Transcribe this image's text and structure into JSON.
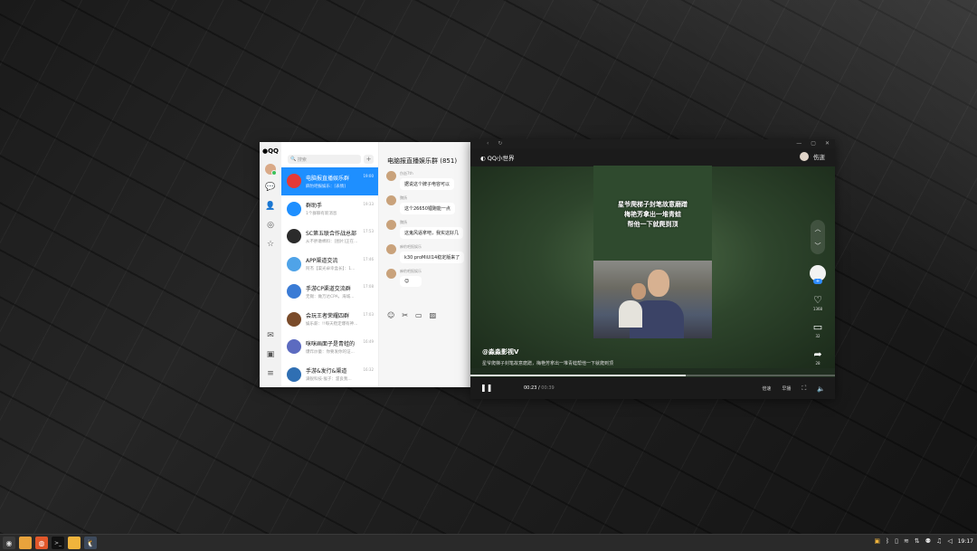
{
  "qq": {
    "logo": "QQ",
    "search_placeholder": "搜索",
    "search_plus": "+",
    "rail_icons": [
      "avatar",
      "message-icon",
      "contacts-icon",
      "space-icon",
      "favorites-icon",
      "mail-icon",
      "doc-icon",
      "menu-icon"
    ],
    "chats": [
      {
        "name": "电脑报直播娱乐群",
        "preview": "麻豹吧报娱乐：[表情]",
        "time": "19:00",
        "color": "#e53935",
        "selected": true
      },
      {
        "name": "群助手",
        "preview": "1个群聊有新消息",
        "time": "19:33",
        "color": "#1e8fff",
        "selected": false
      },
      {
        "name": "SC第五联合作战总部",
        "preview": "从不胖墩棉料：[图片]正在...",
        "time": "17:53",
        "color": "#2b2b2b",
        "selected": false
      },
      {
        "name": "APP渠道交流",
        "preview": "阿杰【渠光卓幸盒长】：1...",
        "time": "17:46",
        "color": "#4fa3e8",
        "selected": false
      },
      {
        "name": "手游CP渠道交流群",
        "preview": "无锡：做万达CPA，海城...",
        "time": "17:08",
        "color": "#3a7bd5",
        "selected": false
      },
      {
        "name": "会玩王者荣耀四群",
        "preview": "娱乐薪：!!每天稳定爆有神...",
        "time": "17:03",
        "color": "#7a4b2a",
        "selected": false
      },
      {
        "name": "咪咪画面子是青蛙的",
        "preview": "爆炸炒童：你要发你的证...",
        "time": "16:49",
        "color": "#5c6bc0",
        "selected": false
      },
      {
        "name": "手游&发行&渠道",
        "preview": "满锐科技·猴子：渥良我...",
        "time": "16:32",
        "color": "#2f6fb3",
        "selected": false
      }
    ],
    "conversation": {
      "title": "电脑报直播娱乐群 (851)",
      "messages": [
        {
          "name": "伤逝7th",
          "text": "据说这个牌子电容可以"
        },
        {
          "name": "魏扬",
          "text": "这个26650锂跑能一点"
        },
        {
          "name": "魏扬",
          "text": "这鬼风逼拿吧，我实这好几"
        },
        {
          "name": "麻豹吧报娱乐",
          "text": "k30 proMiUI14稳定版来了"
        },
        {
          "name": "麻豹吧报娱乐",
          "text": "😊"
        }
      ],
      "tools": [
        "emoji-icon",
        "scissors-icon",
        "folder-icon",
        "image-icon"
      ]
    }
  },
  "video": {
    "brand": "QQ小世界",
    "user": "伤逝",
    "caption_lines": [
      "星爷爬梯子封笔故意磨蹭",
      "梅艳芳拿出一堆青蛙",
      "帮他一下就爬到顶"
    ],
    "author": "@淼淼影视V",
    "description": "星爷爬梯子封笔故意磨蹭，梅艳芳拿出一堆青蛙帮他一下就爬到顶",
    "likes": "1368",
    "comments": "32",
    "shares": "28",
    "time_current": "00:23",
    "time_total": "00:39",
    "progress": 0.59,
    "speed_label": "倍速",
    "quality_label": "早播"
  },
  "taskbar": {
    "apps": [
      "start-icon",
      "files-icon",
      "browser-icon",
      "terminal-icon",
      "folder-icon",
      "qq-icon"
    ],
    "clock": "19:17"
  }
}
